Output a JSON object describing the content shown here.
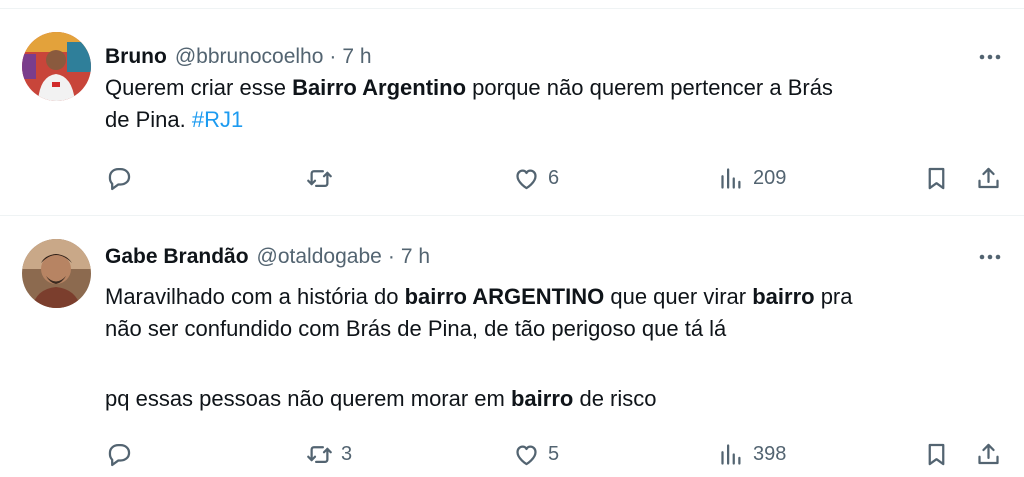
{
  "tweets": [
    {
      "name": "Bruno",
      "handle": "@bbrunocoelho",
      "separator": "·",
      "time": "7 h",
      "line1": {
        "pre": "Querem criar esse ",
        "bold": "Bairro Argentino",
        "post": " porque não querem pertencer a Brás"
      },
      "line2": {
        "pre": "de Pina. ",
        "hashtag": "#RJ1"
      },
      "actions": {
        "reply_count": "",
        "retweet_count": "",
        "like_count": "6",
        "views_count": "209"
      }
    },
    {
      "name": "Gabe Brandão",
      "handle": "@otaldogabe",
      "separator": "·",
      "time": "7 h",
      "line1": {
        "pre": "Maravilhado com a história do ",
        "bold1": "bairro ARGENTINO",
        "mid": " que quer virar ",
        "bold2": "bairro",
        "post": " pra"
      },
      "line2": "não ser confundido com Brás de Pina, de tão perigoso que tá lá",
      "line3": {
        "pre": "pq essas pessoas não querem morar em ",
        "bold": "bairro",
        "post": " de risco"
      },
      "actions": {
        "reply_count": "",
        "retweet_count": "3",
        "like_count": "5",
        "views_count": "398"
      }
    }
  ],
  "icons": {
    "reply": "reply-icon",
    "retweet": "retweet-icon",
    "like": "heart-icon",
    "views": "views-icon",
    "bookmark": "bookmark-icon",
    "share": "share-icon",
    "more": "more-icon"
  },
  "colors": {
    "text": "#0f1419",
    "secondary": "#536471",
    "hashtag": "#1d9bf0",
    "divider": "#eff3f4"
  }
}
